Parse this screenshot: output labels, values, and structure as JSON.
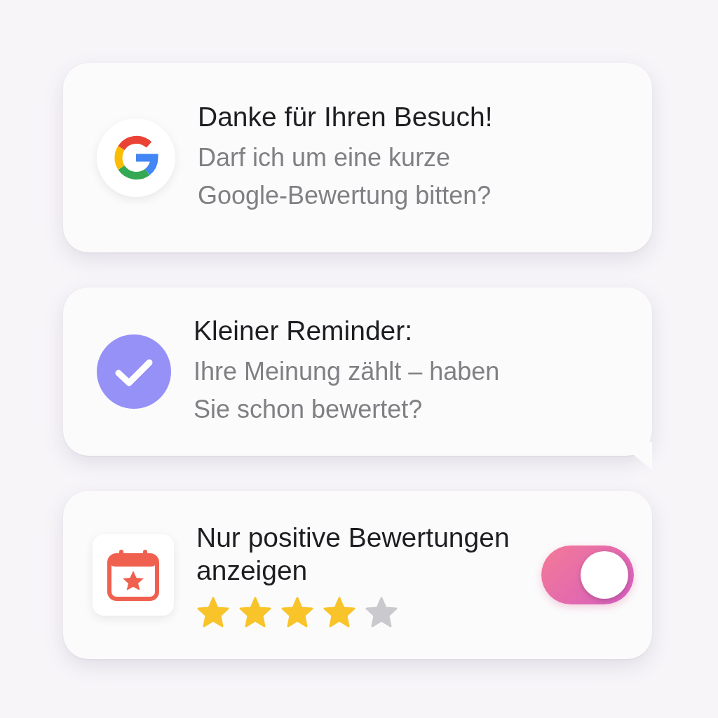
{
  "cards": [
    {
      "kind": "google",
      "title": "Danke für Ihren Besuch!",
      "text": "Darf ich um eine kurze Google-Bewertung bitten?"
    },
    {
      "kind": "check",
      "title": "Kleiner Reminder:",
      "text": "Ihre Meinung zählt – haben Sie schon bewertet?"
    },
    {
      "kind": "calendar",
      "title": "Nur positive Bewertungen anzeigen",
      "stars": 4,
      "toggle_on": true
    }
  ]
}
